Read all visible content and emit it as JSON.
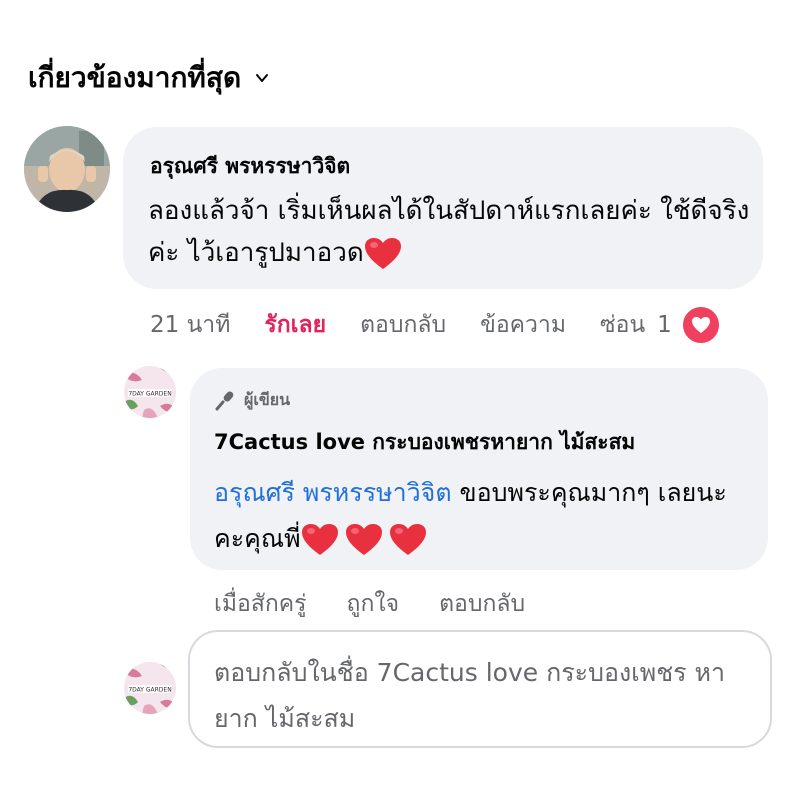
{
  "sort": {
    "label": "เกี่ยวข้องมากที่สุด"
  },
  "comment": {
    "author": "อรุณศรี พรหรรษาวิจิต",
    "text": "ลองแล้วจ้า เริ่มเห็นผลได้ในสัปดาห์แรกเลยค่ะ ใช้ดีจริงค่ะ ไว้เอารูปมาอวด",
    "time": "21 นาที",
    "like_label": "รักเลย",
    "reply_label": "ตอบกลับ",
    "message_label": "ข้อความ",
    "hide_label": "ซ่อน",
    "reaction_count": "1"
  },
  "reply": {
    "badge": "ผู้เขียน",
    "author": "7Cactus love กระบองเพชรหายาก ไม้สะสม",
    "mention": "อรุณศรี พรหรรษาวิจิต",
    "text": "ขอบพระคุณมากๆ เลยนะคะคุณพี่",
    "time": "เมื่อสักครู่",
    "like_label": "ถูกใจ",
    "reply_label": "ตอบกลับ",
    "avatar_text": "7DAY GARDEN"
  },
  "reply_input": {
    "placeholder": "ตอบกลับในชื่อ 7Cactus love กระบองเพชร หายาก ไม้สะสม"
  },
  "colors": {
    "bubble": "#f0f2f5",
    "heart": "#e8303f",
    "link": "#216fdb",
    "love": "#e0245e",
    "meta": "#65676b"
  }
}
